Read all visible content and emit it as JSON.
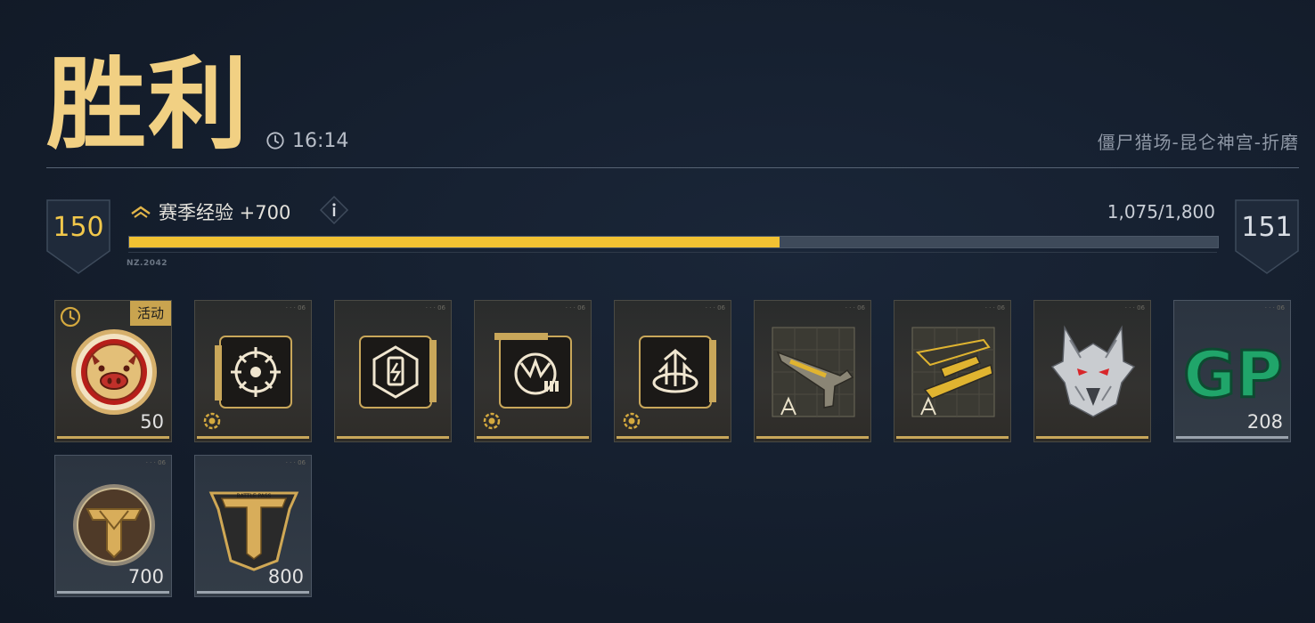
{
  "header": {
    "result_title": "胜利",
    "match_time": "16:14",
    "mode_name": "僵尸猎场-昆仑神宫-折磨"
  },
  "progress": {
    "current_level": "150",
    "next_level": "151",
    "xp_label": "赛季经验 +700",
    "xp_count": "1,075/1,800",
    "fraction": 0.597,
    "small_tag": "NZ.2042"
  },
  "colors": {
    "title_gold": "#f1d083",
    "bar_fill": "#f2c232",
    "accent_gold": "#c9a75a"
  },
  "rewards": [
    {
      "name": "pig-coin",
      "icon": "pig-face-icon",
      "amount": "50",
      "tag": "活动",
      "style": "gold"
    },
    {
      "name": "core-module-target",
      "icon": "target-module-icon",
      "amount": "",
      "style": "gold"
    },
    {
      "name": "core-module-battery",
      "icon": "battery-module-icon",
      "amount": "",
      "style": "gold"
    },
    {
      "name": "core-module-ammo",
      "icon": "ammo-module-icon",
      "amount": "",
      "style": "gold"
    },
    {
      "name": "core-module-spike",
      "icon": "spike-module-icon",
      "amount": "",
      "style": "gold"
    },
    {
      "name": "pistol-blueprint",
      "icon": "pistol-blueprint-icon",
      "amount": "",
      "style": "gold"
    },
    {
      "name": "rifle-blueprint",
      "icon": "rifle-blueprint-icon",
      "amount": "",
      "style": "gold"
    },
    {
      "name": "wolf-head",
      "icon": "wolf-head-icon",
      "amount": "",
      "style": "gold"
    },
    {
      "name": "gp-currency",
      "icon": "gp-icon",
      "amount": "208",
      "style": "grey"
    },
    {
      "name": "t-coin",
      "icon": "t-coin-icon",
      "amount": "700",
      "style": "grey"
    },
    {
      "name": "battle-pass-xp",
      "icon": "battle-pass-icon",
      "amount": "800",
      "style": "grey"
    }
  ]
}
